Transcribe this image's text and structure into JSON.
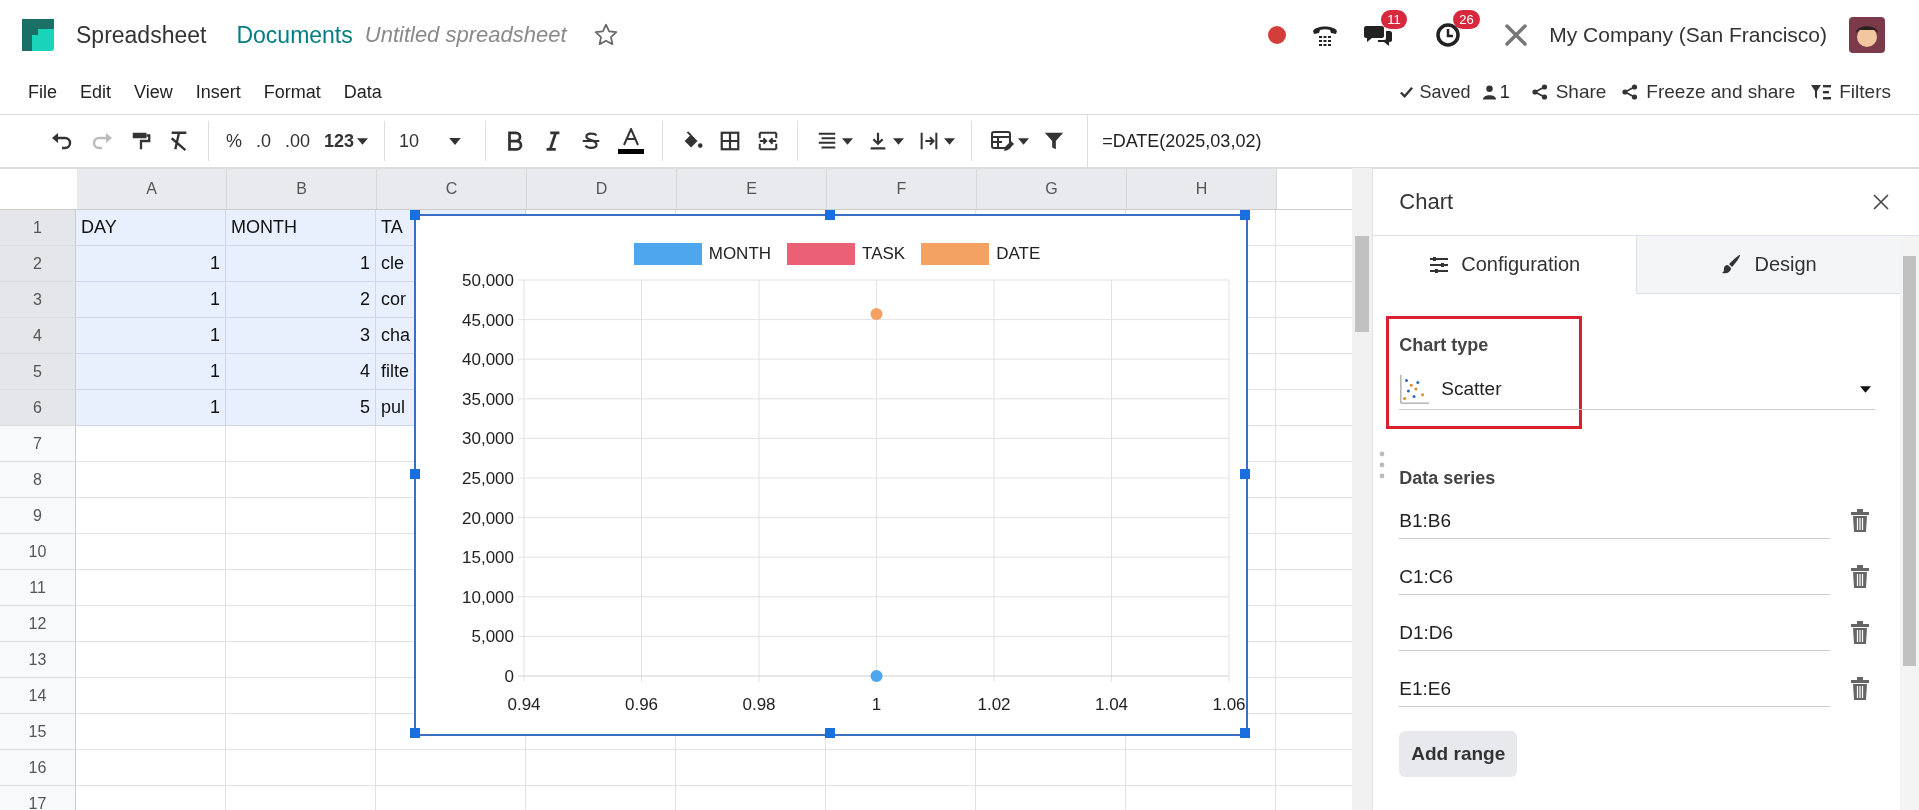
{
  "app": {
    "name": "Spreadsheet",
    "breadcrumb": "Documents",
    "document": "Untitled spreadsheet",
    "messages_badge": "11",
    "activities_badge": "26",
    "company": "My Company (San Francisco)"
  },
  "menu": [
    "File",
    "Edit",
    "View",
    "Insert",
    "Format",
    "Data"
  ],
  "status": {
    "saved": "Saved",
    "users": "1",
    "actions": [
      {
        "kind": "share",
        "label": "Share"
      },
      {
        "kind": "share",
        "label": "Freeze and share"
      },
      {
        "kind": "filters",
        "label": "Filters"
      }
    ]
  },
  "toolbar": {
    "number_formats": [
      "%",
      ".0",
      ".00",
      "123"
    ],
    "font_size": "10",
    "formula": "=DATE(2025,03,02)"
  },
  "grid": {
    "columns": [
      "A",
      "B",
      "C",
      "D",
      "E",
      "F",
      "G",
      "H"
    ],
    "rows": [
      {
        "label": "1",
        "selected": true,
        "cells": [
          {
            "text": "DAY",
            "kind": "text",
            "selected": true
          },
          {
            "text": "MONTH",
            "kind": "text",
            "selected": true
          },
          {
            "text": "TA",
            "kind": "text",
            "selected": true
          }
        ]
      },
      {
        "label": "2",
        "selected": true,
        "cells": [
          {
            "text": "1",
            "kind": "number",
            "selected": true
          },
          {
            "text": "1",
            "kind": "number",
            "selected": true
          },
          {
            "text": "cle",
            "kind": "text",
            "selected": true
          }
        ]
      },
      {
        "label": "3",
        "selected": true,
        "cells": [
          {
            "text": "1",
            "kind": "number",
            "selected": true
          },
          {
            "text": "2",
            "kind": "number",
            "selected": true
          },
          {
            "text": "cor",
            "kind": "text",
            "selected": true
          }
        ]
      },
      {
        "label": "4",
        "selected": true,
        "cells": [
          {
            "text": "1",
            "kind": "number",
            "selected": true
          },
          {
            "text": "3",
            "kind": "number",
            "selected": true
          },
          {
            "text": "cha",
            "kind": "text",
            "selected": true
          }
        ]
      },
      {
        "label": "5",
        "selected": true,
        "cells": [
          {
            "text": "1",
            "kind": "number",
            "selected": true
          },
          {
            "text": "4",
            "kind": "number",
            "selected": true
          },
          {
            "text": "filte",
            "kind": "text",
            "selected": true
          }
        ]
      },
      {
        "label": "6",
        "selected": true,
        "cells": [
          {
            "text": "1",
            "kind": "number",
            "selected": true
          },
          {
            "text": "5",
            "kind": "number",
            "selected": true
          },
          {
            "text": "pul",
            "kind": "text",
            "selected": true
          }
        ]
      },
      {
        "label": "7",
        "selected": false
      },
      {
        "label": "8",
        "selected": false
      },
      {
        "label": "9",
        "selected": false
      },
      {
        "label": "10",
        "selected": false
      },
      {
        "label": "11",
        "selected": false
      },
      {
        "label": "12",
        "selected": false
      },
      {
        "label": "13",
        "selected": false
      },
      {
        "label": "14",
        "selected": false
      },
      {
        "label": "15",
        "selected": false
      },
      {
        "label": "16",
        "selected": false
      },
      {
        "label": "17",
        "selected": false
      }
    ]
  },
  "chart": {
    "chart_data": {
      "type": "scatter",
      "x": [
        1
      ],
      "series": [
        {
          "name": "MONTH",
          "color": "#4ea6ee",
          "values": [
            0
          ]
        },
        {
          "name": "TASK",
          "color": "#ea6175",
          "values": [
            null
          ]
        },
        {
          "name": "DATE",
          "color": "#f3a263",
          "values": [
            45700
          ]
        }
      ],
      "xlim": [
        0.94,
        1.06
      ],
      "ylim": [
        0,
        50000
      ],
      "grid": true,
      "xticks": [
        0.94,
        0.96,
        0.98,
        1,
        1.02,
        1.04,
        1.06
      ],
      "yticks": [
        {
          "value": 0,
          "label": "0"
        },
        {
          "value": 5000,
          "label": "5,000"
        },
        {
          "value": 10000,
          "label": "10,000"
        },
        {
          "value": 15000,
          "label": "15,000"
        },
        {
          "value": 20000,
          "label": "20,000"
        },
        {
          "value": 25000,
          "label": "25,000"
        },
        {
          "value": 30000,
          "label": "30,000"
        },
        {
          "value": 35000,
          "label": "35,000"
        },
        {
          "value": 40000,
          "label": "40,000"
        },
        {
          "value": 45000,
          "label": "45,000"
        },
        {
          "value": 50000,
          "label": "50,000"
        }
      ]
    }
  },
  "panel": {
    "title": "Chart",
    "tabs": [
      {
        "kind": "configuration",
        "label": "Configuration",
        "selected": true
      },
      {
        "kind": "design",
        "label": "Design",
        "selected": false
      }
    ],
    "chart_type": {
      "label": "Chart type",
      "value": "Scatter",
      "highlighted": true
    },
    "series_label": "Data series",
    "ranges": [
      "B1:B6",
      "C1:C6",
      "D1:D6",
      "E1:E6"
    ],
    "add_button": "Add range"
  }
}
